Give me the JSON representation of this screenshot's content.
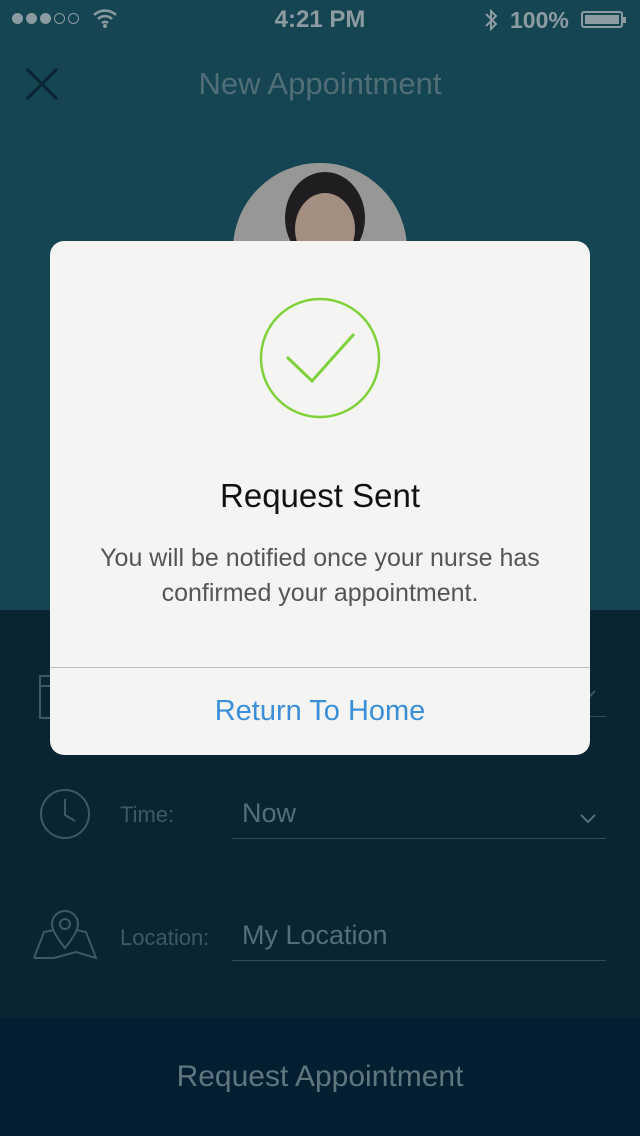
{
  "status_bar": {
    "time": "4:21 PM",
    "battery": "100%"
  },
  "nav": {
    "title": "New Appointment"
  },
  "form": {
    "time_label": "Time:",
    "time_value": "Now",
    "location_label": "Location:",
    "location_value": "My Location"
  },
  "cta": {
    "label": "Request Appointment"
  },
  "alert": {
    "title": "Request Sent",
    "message": "You will be notified once your nurse has confirmed your appointment.",
    "button_label": "Return To Home"
  },
  "icons": {
    "close": "close-icon",
    "calendar": "calendar-icon",
    "clock": "clock-icon",
    "map": "map-pin-icon",
    "chevron": "chevron-down-icon",
    "check": "checkmark-icon"
  },
  "colors": {
    "header_bg": "#1f5a69",
    "form_bg": "#0f2d3b",
    "cta_bg": "#06243a",
    "alert_bg": "#f4f4f3",
    "check_green": "#7fd13b",
    "link_blue": "#3a8fd8"
  }
}
